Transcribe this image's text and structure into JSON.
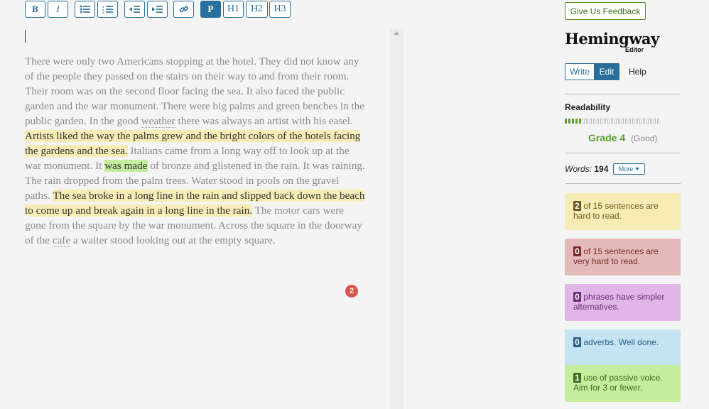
{
  "toolbar": {
    "bold": "B",
    "italic": "I",
    "paragraph": "P",
    "h1": "H1",
    "h2": "H2",
    "h3": "H3"
  },
  "editor": {
    "paragraph": [
      {
        "text": "There were only two Americans stopping at the hotel. They did not know any of the people they passed on the stairs on their way to and from their room. Their room was on the second floor facing the sea. It also faced the public garden and the war monument. There were big palms and green benches in the public garden. In the good ",
        "style": "plain"
      },
      {
        "text": "weather",
        "style": "underline"
      },
      {
        "text": " there was always an artist with his easel. ",
        "style": "plain"
      },
      {
        "text": "Artists liked the way the palms grew and the bright colors of the hotels facing the gardens and the sea.",
        "style": "hard"
      },
      {
        "text": " Italians came from a long way off to look up at the war monument. It ",
        "style": "plain"
      },
      {
        "text": "was made",
        "style": "passive"
      },
      {
        "text": " of bronze and glistened in the rain. It was raining. The rain dropped from the palm trees. Water stood in pools on the gravel paths. ",
        "style": "plain"
      },
      {
        "text": "The sea broke in a long line in the rain and slipped back down the beach to come up and break again in a long line in the rain.",
        "style": "hard"
      },
      {
        "text": " The motor cars were gone from the square by the war monument. Across the square in the doorway of the ",
        "style": "plain"
      },
      {
        "text": "cafe",
        "style": "underline"
      },
      {
        "text": " a waiter stood looking out at the empty square.",
        "style": "plain"
      }
    ],
    "badge": "2"
  },
  "sidebar": {
    "feedback": "Give Us Feedback",
    "logo": "Hemingway",
    "logo_sub": "Editor",
    "write": "Write",
    "edit": "Edit",
    "help": "Help",
    "readability_label": "Readability",
    "readability_filled": 0.17,
    "grade": "Grade 4",
    "grade_note": "(Good)",
    "words_label": "Words:",
    "words_count": "194",
    "more": "More",
    "cards": [
      {
        "count": "2",
        "text": "of 15 sentences are hard to read.",
        "bg": "#f7ecb5",
        "fg": "#6b5a1a",
        "numbg": "#6b5a1a"
      },
      {
        "count": "0",
        "text": "of 15 sentences are very hard to read.",
        "bg": "#e4b9b9",
        "fg": "#7a2a2a",
        "numbg": "#7a2a2a"
      },
      {
        "count": "0",
        "text": "phrases have simpler alternatives.",
        "bg": "#e0b6e8",
        "fg": "#6a2a75",
        "numbg": "#6a2a75"
      },
      {
        "count": "0",
        "text": "adverbs. Well done.",
        "bg": "#c4e3f3",
        "fg": "#2a5f86",
        "numbg": "#2a5f86"
      },
      {
        "count": "1",
        "text": "use of passive voice. Aim for 3 or fewer.",
        "bg": "#c4ed9d",
        "fg": "#3e6e15",
        "numbg": "#3e6e15"
      }
    ]
  },
  "colors": {
    "accent": "#2a6f9b",
    "grade_green": "#5a9b2a",
    "hard": "#f7ecb5",
    "passive": "#c4ed9d",
    "badge": "#d9534f"
  }
}
